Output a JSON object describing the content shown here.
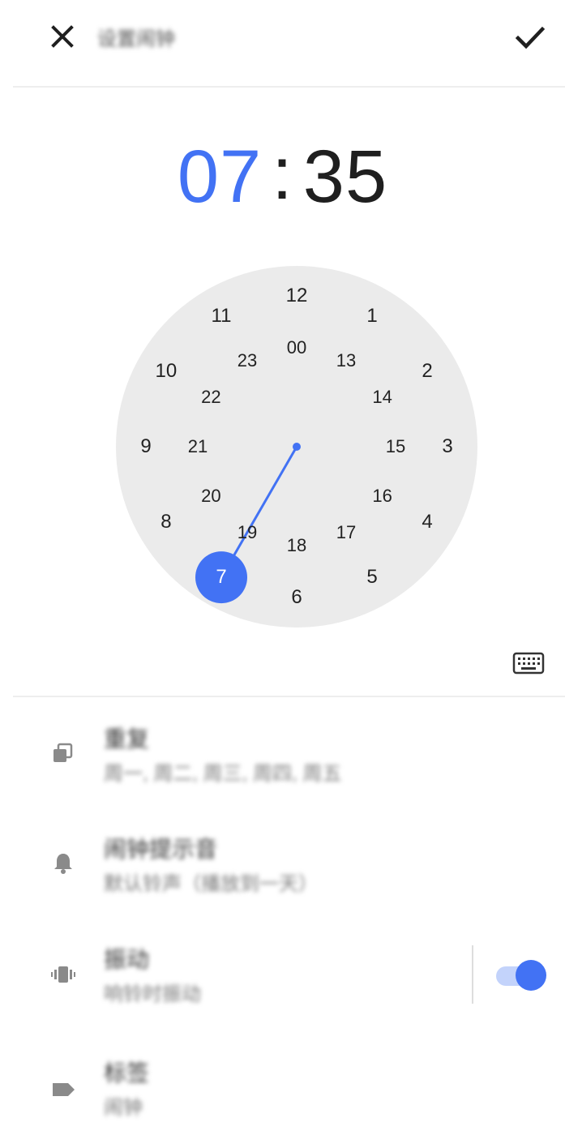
{
  "header": {
    "title": "设置闹钟",
    "close_icon": "close-icon",
    "confirm_icon": "check-icon"
  },
  "time": {
    "hour": "07",
    "separator": ":",
    "minute": "35",
    "selected_color": "#4272f4"
  },
  "clock": {
    "outer_numbers": [
      "12",
      "1",
      "2",
      "3",
      "4",
      "5",
      "6",
      "7",
      "8",
      "9",
      "10",
      "11"
    ],
    "inner_numbers": [
      "00",
      "13",
      "14",
      "15",
      "16",
      "17",
      "18",
      "19",
      "20",
      "21",
      "22",
      "23"
    ],
    "selected": "7",
    "accent": "#4272f4",
    "face_color": "#ebebeb"
  },
  "keyboard_icon": "keyboard-icon",
  "settings": {
    "repeat": {
      "icon": "repeat-icon",
      "title": "重复",
      "subtitle": "周一, 周二, 周三, 周四, 周五"
    },
    "ringtone": {
      "icon": "bell-icon",
      "title": "闹钟提示音",
      "subtitle": "默认铃声（播放到一天）"
    },
    "vibrate": {
      "icon": "vibrate-icon",
      "title": "振动",
      "subtitle": "响铃时振动",
      "enabled": true
    },
    "label": {
      "icon": "tag-icon",
      "title": "标签",
      "subtitle": "闹钟"
    }
  }
}
